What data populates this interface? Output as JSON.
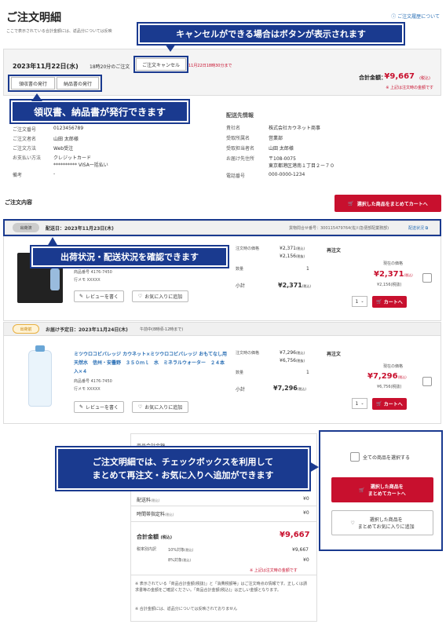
{
  "header": {
    "title": "ご注文明細",
    "history_link": "ご注文履歴について",
    "intro": "ここで表示されている合計金額には、返品分については反映"
  },
  "order": {
    "date": "2023年11月22日(水)",
    "time": "18時20分のご注文",
    "cancel_button": "ご注文キャンセル",
    "cancel_deadline": "11月22日18時30分まで",
    "receipt_button": "領収書の発行",
    "delivery_note_button": "納品書の発行",
    "total_label": "合計金額：",
    "total_value": "¥9,667",
    "total_tax": "(税込)",
    "total_note": "※ 上記は注文時の金額です"
  },
  "callouts": {
    "cancel": "キャンセルができる場合はボタンが表示されます",
    "documents": "領収書、納品書が発行できます",
    "shipping": "出荷状況・配送状況を確認できます",
    "checkbox": "ご注文明細では、チェックボックスを利用して\nまとめて再注文・お気に入りへ追加ができます"
  },
  "order_info": {
    "rows": [
      {
        "label": "ご注文番号",
        "value": "0123456789"
      },
      {
        "label": "ご注文者名",
        "value": "山田 太郎様"
      },
      {
        "label": "ご注文方法",
        "value": "Web受注"
      },
      {
        "label": "お支払い方法",
        "value": "クレジットカード"
      },
      {
        "label": "",
        "value": "********** VISA一括払い"
      },
      {
        "label": "備考",
        "value": "-"
      }
    ]
  },
  "delivery_info": {
    "heading": "配送先情報",
    "rows": [
      {
        "label": "貴社名",
        "value": "株式会社カウネット商事"
      },
      {
        "label": "受取所属名",
        "value": "営業部"
      },
      {
        "label": "受取担当者名",
        "value": "山田 太郎様"
      },
      {
        "label": "お届け先住所",
        "value": "〒108-0075"
      },
      {
        "label": "",
        "value": "東京都港区港南１丁目２ー７０"
      },
      {
        "label": "電話番号",
        "value": "000-0000-1234"
      }
    ]
  },
  "order_contents": {
    "heading": "ご注文内容",
    "add_selected_cart": "選択した商品をまとめてカートへ"
  },
  "shipment1": {
    "status": "出荷済",
    "delivery_date": "配送日：2023年11月23日(木)",
    "tracking": "貨物問合せ番号：300115479764(佐川急便部配業務部)",
    "tracking_link": "配送状況",
    "product_code": "商品番号 4176-7450",
    "memo": "行メモ XXXXX",
    "review_button": "レビューを書く",
    "fav_button": "お気に入りに追加",
    "price_label": "注文時の価格",
    "price_tax": "¥2,371",
    "price_notax": "¥2,156",
    "tax_in": "(税込)",
    "tax_out": "(税抜)",
    "qty_label": "数量",
    "qty": "1",
    "subtotal_label": "小計",
    "subtotal": "¥2,371",
    "reorder_label": "再注文",
    "current_price_label": "現在の価格",
    "current_price": "¥2,371",
    "current_notax": "¥2,156",
    "qty_select": "1",
    "cart_button": "カートへ"
  },
  "shipment2": {
    "status": "出荷前",
    "delivery_date": "お届け予定日：2023年11月24日(木)",
    "delivery_time": "午前中(8時頃-12時まで)",
    "product_name": "ミツウロコビバレッジ カウネット×ミツウロコビバレッジ おもてなし用天然水　信州・安曇野　３５０ｍｌ　水　ミネラルウォーター　２４本入×４",
    "product_code": "商品番号 4176-7450",
    "memo": "行メモ XXXXX",
    "review_button": "レビューを書く",
    "fav_button": "お気に入りに追加",
    "price_label": "注文時の価格",
    "price_tax": "¥7,296",
    "price_notax": "¥6,756",
    "tax_in": "(税込)",
    "tax_out": "(税抜)",
    "qty_label": "数量",
    "qty": "1",
    "subtotal_label": "小計",
    "subtotal": "¥7,296",
    "reorder_label": "再注文",
    "current_price_label": "現在の価格",
    "current_price": "¥7,296",
    "current_notax": "¥6,756",
    "qty_select": "1",
    "cart_button": "カートへ"
  },
  "summary": {
    "row1_label": "商品合計金額",
    "row2_label": "",
    "row3_label": "",
    "shipping_label": "配送料",
    "shipping_tax": "(税込)",
    "shipping_value": "¥0",
    "timefee_label": "時間帯指定料",
    "timefee_tax": "(税込)",
    "timefee_value": "¥0",
    "total_label": "合計金額",
    "total_tax": "(税込)",
    "total_value": "¥9,667",
    "tax_breakdown_label": "税率別内訳",
    "rate10_label": "10%対象",
    "rate10_tax": "(税込)",
    "rate10_value": "¥9,667",
    "rate8_label": "8%対象",
    "rate8_tax": "(税込)",
    "rate8_value": "¥0",
    "summary_note": "※ 上記は注文時の金額です",
    "note1": "※ 表示されている「商品合計金額(税抜)」と「消費税額等」はご注文時点の情報です。正しくは請求書等の金額をご確認ください。「商品合計金額(税込)」は正しい金額となります。",
    "note2": "※ 合計金額には、返品分については反映されておりません"
  },
  "side_panel": {
    "select_all": "全ての商品を選択する",
    "cart_button": "選択した商品を\nまとめてカートへ",
    "fav_button": "選択した商品を\nまとめてお気に入りに追加"
  }
}
